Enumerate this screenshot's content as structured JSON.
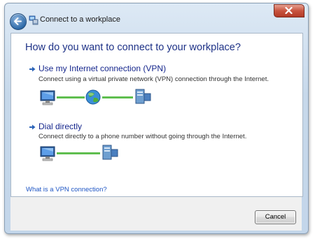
{
  "window": {
    "title": "Connect to a workplace",
    "icon": "network-connection-icon"
  },
  "titlebar": {
    "back_icon": "back-arrow-icon",
    "close_icon": "close-icon"
  },
  "main": {
    "heading": "How do you want to connect to your workplace?",
    "options": [
      {
        "title": "Use my Internet connection (VPN)",
        "description": "Connect using a virtual private network (VPN) connection through the Internet.",
        "icon": "blue-arrow-icon",
        "diagram": [
          "computer-icon",
          "globe-icon",
          "server-icon"
        ]
      },
      {
        "title": "Dial directly",
        "description": "Connect directly to a phone number without going through the Internet.",
        "icon": "blue-arrow-icon",
        "diagram": [
          "computer-icon",
          "server-icon"
        ]
      }
    ],
    "help_link": "What is a VPN connection?"
  },
  "footer": {
    "cancel_label": "Cancel"
  },
  "colors": {
    "heading": "#1e3287",
    "link": "#1f56c4",
    "connector_line": "#5fbe4f"
  }
}
